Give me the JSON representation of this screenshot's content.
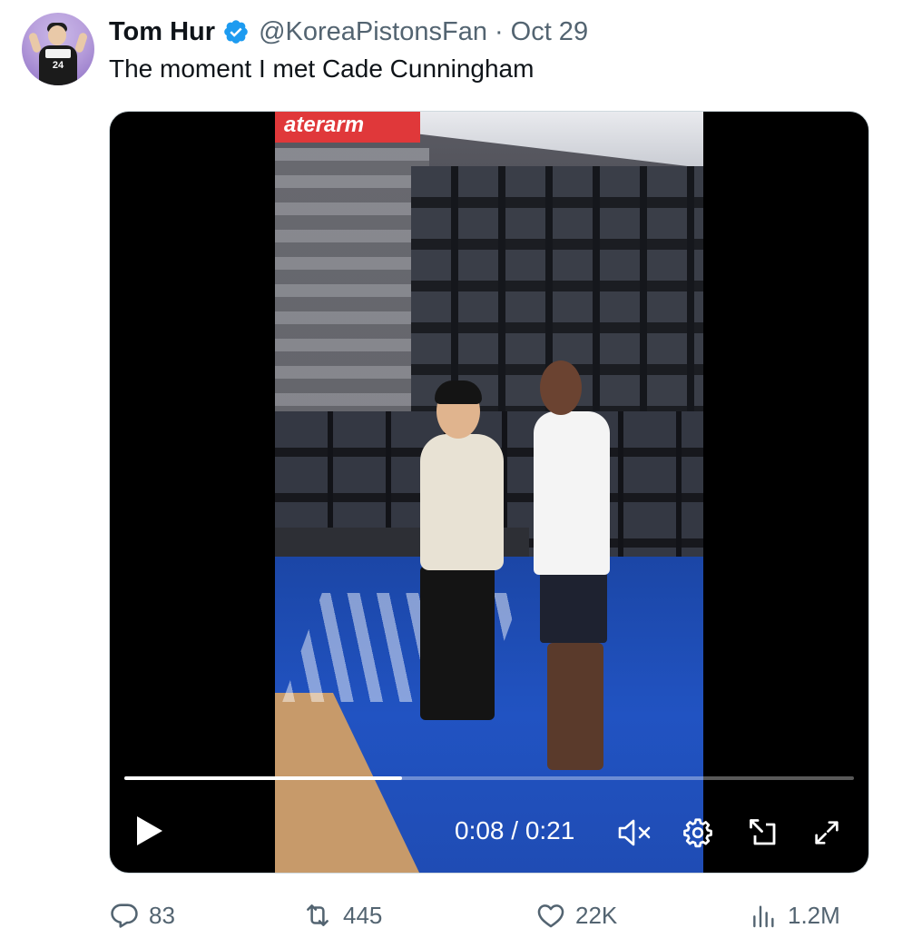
{
  "tweet": {
    "author_name": "Tom Hur",
    "handle": "@KoreaPistonsFan",
    "separator": "·",
    "date": "Oct 29",
    "text": "The moment I met Cade Cunningham",
    "avatar_number": "24"
  },
  "video": {
    "banner_text": "aterarm",
    "time_display": "0:08 / 0:21",
    "progress_fraction": 0.381,
    "muted": true
  },
  "actions": {
    "replies": "83",
    "retweets": "445",
    "likes": "22K",
    "views": "1.2M"
  },
  "colors": {
    "verified": "#1d9bf0",
    "secondary_text": "#536471",
    "primary_text": "#0f1419"
  }
}
